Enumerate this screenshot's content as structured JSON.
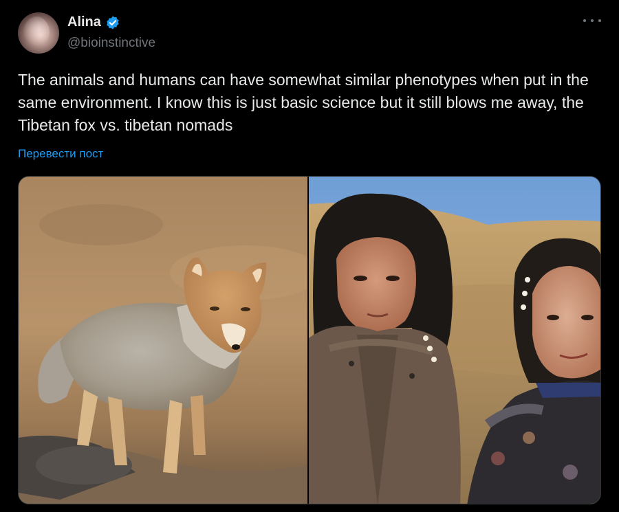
{
  "author": {
    "name": "Alina",
    "handle": "@bioinstinctive",
    "verified": true
  },
  "post": {
    "text": "The animals and humans can have somewhat similar phenotypes when put in the same environment. I know this is just basic science but it still blows me away, the Tibetan fox vs. tibetan nomads",
    "translate_label": "Перевести пост"
  },
  "media": [
    {
      "description_icon": "tibetan-fox-photo"
    },
    {
      "description_icon": "tibetan-nomad-children-photo"
    }
  ],
  "colors": {
    "background": "#000000",
    "text": "#e7e9ea",
    "secondary": "#71767b",
    "accent": "#1d9bf0"
  }
}
